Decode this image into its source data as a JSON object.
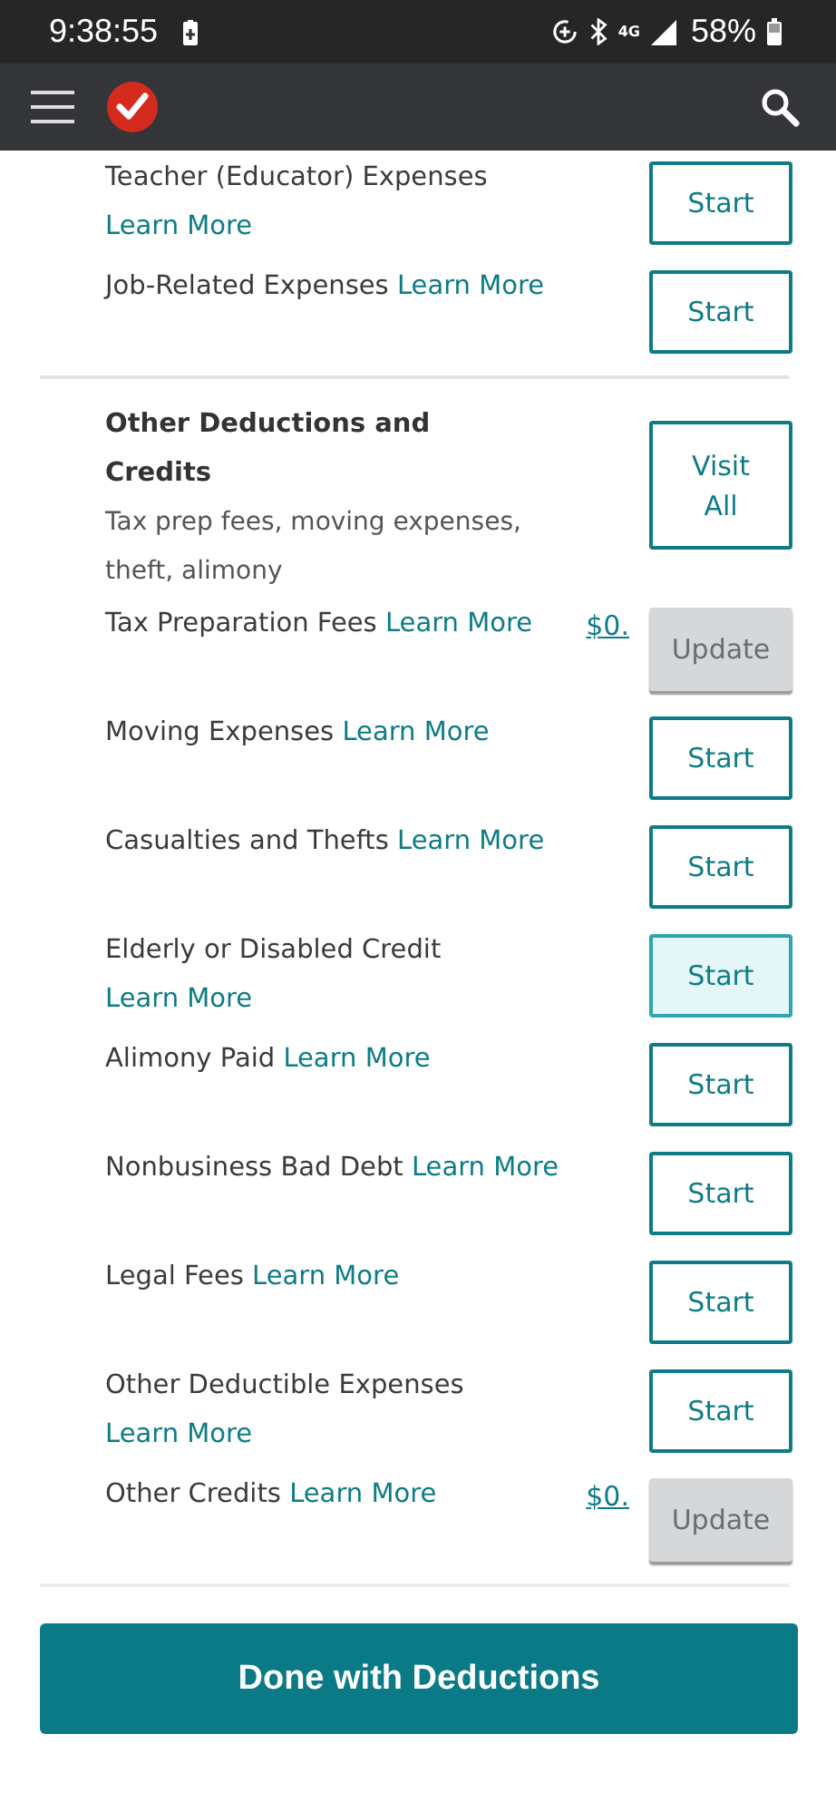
{
  "status_bar": {
    "time": "9:38:55",
    "battery": "58%",
    "network": "4G"
  },
  "rows_top": [
    {
      "label": "Teacher (Educator) Expenses",
      "link": "Learn More",
      "button": {
        "kind": "start",
        "label": "Start",
        "highlighted": false
      }
    },
    {
      "label": "Job-Related Expenses",
      "link": "Learn More",
      "button": {
        "kind": "start",
        "label": "Start",
        "highlighted": false
      }
    }
  ],
  "section": {
    "title": "Other Deductions and Credits",
    "description": "Tax prep fees, moving expenses, theft, alimony",
    "button": "Visit All"
  },
  "rows": [
    {
      "label": "Tax Preparation Fees",
      "link": "Learn More",
      "amount": "$0.",
      "button": {
        "kind": "update",
        "label": "Update"
      }
    },
    {
      "label": "Moving Expenses",
      "link": "Learn More",
      "button": {
        "kind": "start",
        "label": "Start",
        "highlighted": false
      }
    },
    {
      "label": "Casualties and Thefts",
      "link": "Learn More",
      "button": {
        "kind": "start",
        "label": "Start",
        "highlighted": false
      }
    },
    {
      "label": "Elderly or Disabled Credit",
      "link": "Learn More",
      "button": {
        "kind": "start",
        "label": "Start",
        "highlighted": true
      }
    },
    {
      "label": "Alimony Paid",
      "link": "Learn More",
      "button": {
        "kind": "start",
        "label": "Start",
        "highlighted": false
      }
    },
    {
      "label": "Nonbusiness Bad Debt",
      "link": "Learn More",
      "button": {
        "kind": "start",
        "label": "Start",
        "highlighted": false
      }
    },
    {
      "label": "Legal Fees",
      "link": "Learn More",
      "button": {
        "kind": "start",
        "label": "Start",
        "highlighted": false
      }
    },
    {
      "label": "Other Deductible Expenses",
      "link": "Learn More",
      "button": {
        "kind": "start",
        "label": "Start",
        "highlighted": false
      }
    },
    {
      "label": "Other Credits",
      "link": "Learn More",
      "amount": "$0.",
      "button": {
        "kind": "update",
        "label": "Update"
      }
    }
  ],
  "done_button": "Done with Deductions"
}
